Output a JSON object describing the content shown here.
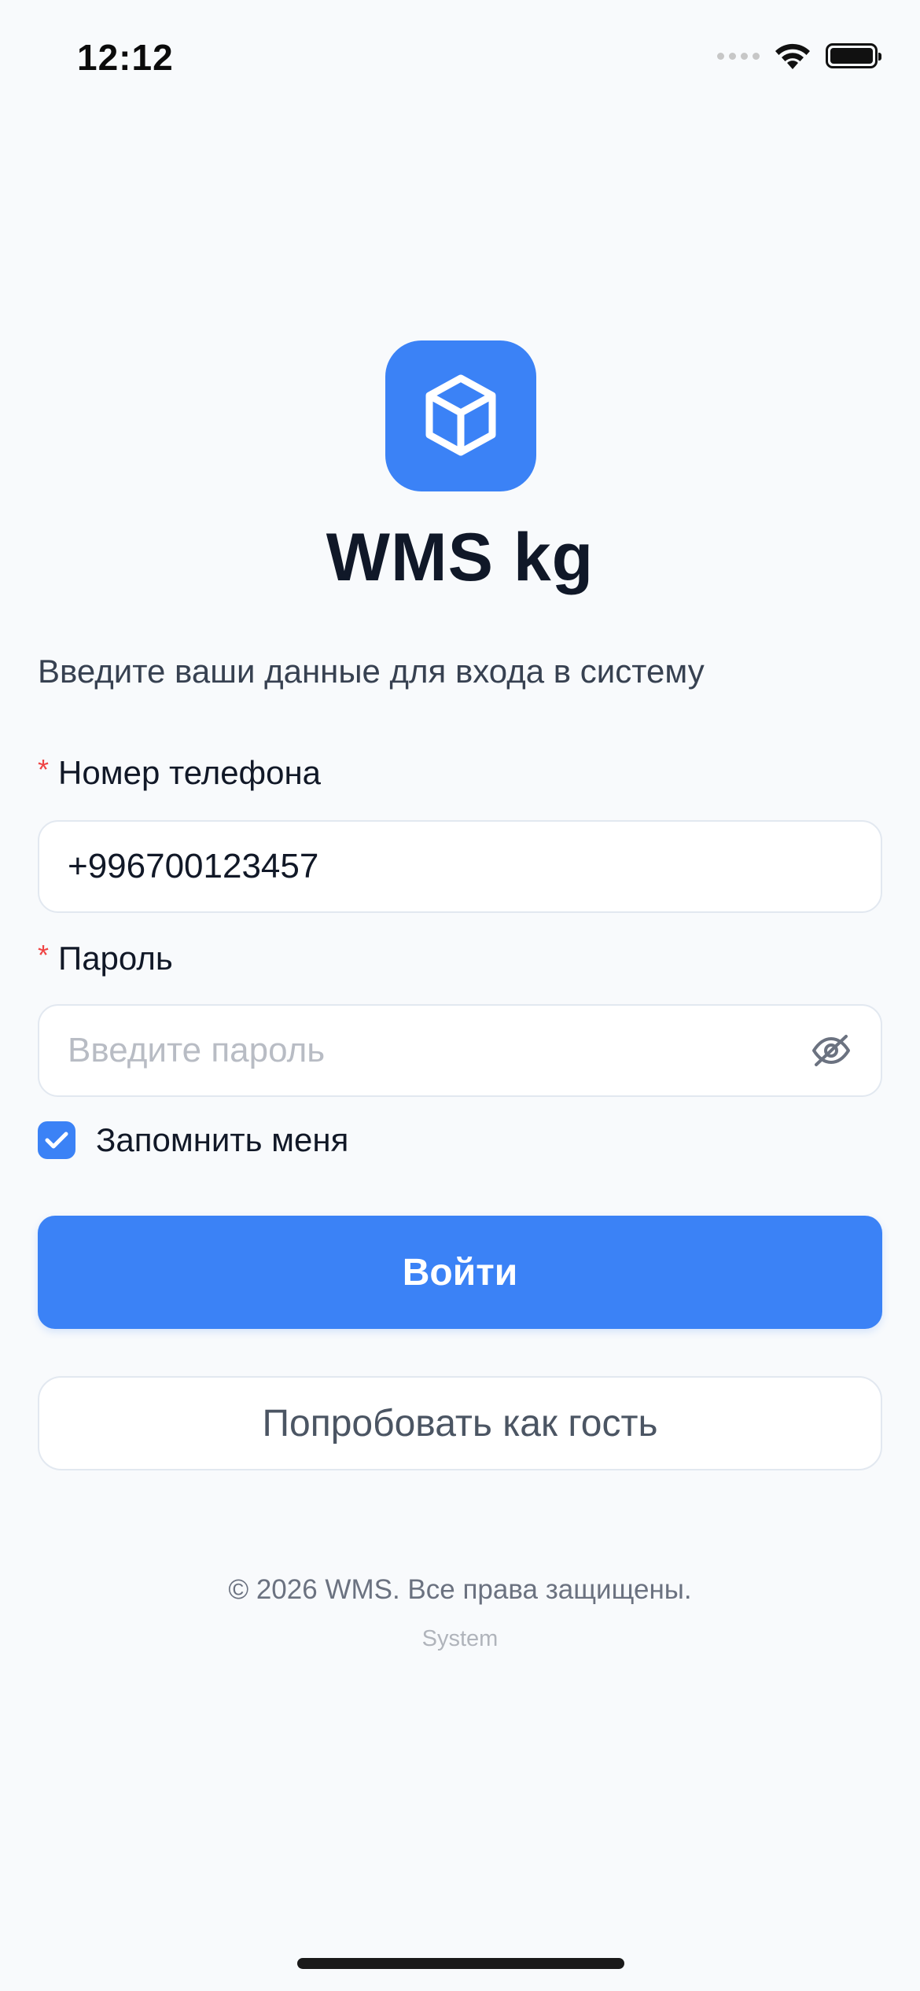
{
  "status_bar": {
    "time": "12:12",
    "icons": [
      "signal-dots-icon",
      "wifi-icon",
      "battery-icon"
    ]
  },
  "header": {
    "logo_icon": "cube-icon",
    "app_title": "WMS kg"
  },
  "subtitle": "Введите ваши данные для входа в систему",
  "form": {
    "phone": {
      "required_mark": "*",
      "label": "Номер телефона",
      "value": "+996700123457",
      "placeholder": ""
    },
    "password": {
      "required_mark": "*",
      "label": "Пароль",
      "value": "",
      "placeholder": "Введите пароль",
      "toggle_icon": "eye-off-icon"
    },
    "remember": {
      "label": "Запомнить меня",
      "checked": true
    }
  },
  "actions": {
    "login_label": "Войти",
    "guest_label": "Попробовать как гость"
  },
  "footer": {
    "copyright": "© 2026 WMS. Все права защищены.",
    "system": "System"
  },
  "colors": {
    "accent": "#3b82f6",
    "background": "#f8fafc",
    "required": "#ef4444"
  }
}
